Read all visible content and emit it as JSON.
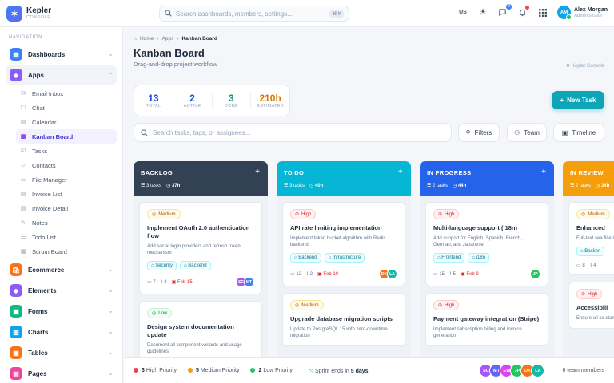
{
  "app": {
    "name": "Kepler",
    "sub": "CONSOLE"
  },
  "search": {
    "placeholder": "Search dashboards, members, settings...",
    "shortcut": "⌘ K"
  },
  "topbar": {
    "lang": "US",
    "chat_badge": "3",
    "user_initials": "AM",
    "user_name": "Alex Morgan",
    "user_role": "Administrator"
  },
  "sidebar": {
    "caption": "NAVIGATION",
    "dashboards": "Dashboards",
    "apps": "Apps",
    "sub": [
      "Email Inbox",
      "Chat",
      "Calendar",
      "Kanban Board",
      "Tasks",
      "Contacts",
      "File Manager",
      "Invoice List",
      "Invoice Detail",
      "Notes",
      "Todo List",
      "Scrum Board"
    ],
    "bottom": [
      "Ecommerce",
      "Elements",
      "Forms",
      "Charts",
      "Tables",
      "Pages"
    ]
  },
  "page": {
    "crumbs": [
      "Home",
      "Apps",
      "Kanban Board"
    ],
    "title": "Kanban Board",
    "subtitle": "Drag-and-drop project workflow",
    "brand": "Kepler Console"
  },
  "stats": [
    {
      "value": "13",
      "label": "TOTAL",
      "color": "#1d4ed8"
    },
    {
      "value": "2",
      "label": "ACTIVE",
      "color": "#1d4ed8"
    },
    {
      "value": "3",
      "label": "DONE",
      "color": "#059669"
    },
    {
      "value": "210h",
      "label": "ESTIMATED",
      "color": "#d97706"
    }
  ],
  "new_task": "New Task",
  "task_search": "Search tasks, tags, or assignees...",
  "buttons": {
    "filters": "Filters",
    "team": "Team",
    "timeline": "Timeline"
  },
  "columns": [
    {
      "title": "BACKLOG",
      "tasks": "3 tasks",
      "hours": "37h",
      "color": "#334155",
      "cards": [
        {
          "priority": "Medium",
          "level": "medium",
          "title": "Implement OAuth 2.0 authentication flow",
          "desc": "Add social login providers and refresh token mechanism",
          "tags": [
            "Security",
            "Backend"
          ],
          "comments": "7",
          "files": "3",
          "due": "Feb 15",
          "avatars": [
            {
              "i": "SC",
              "c": "#a855f7"
            },
            {
              "i": "MT",
              "c": "#3b82f6"
            }
          ]
        },
        {
          "priority": "Low",
          "level": "low",
          "title": "Design system documentation update",
          "desc": "Document all component variants and usage guidelines",
          "tags": [],
          "comments": "",
          "files": "",
          "due": "",
          "avatars": []
        }
      ]
    },
    {
      "title": "TO DO",
      "tasks": "3 tasks",
      "hours": "40h",
      "color": "#06b6d4",
      "cards": [
        {
          "priority": "High",
          "level": "high",
          "title": "API rate limiting implementation",
          "desc": "Implement token bucket algorithm with Redis backend",
          "tags": [
            "Backend",
            "Infrastructure"
          ],
          "comments": "12",
          "files": "2",
          "due": "Feb 10",
          "avatars": [
            {
              "i": "DK",
              "c": "#f97316"
            },
            {
              "i": "LA",
              "c": "#14b8a6"
            }
          ]
        },
        {
          "priority": "Medium",
          "level": "medium",
          "title": "Upgrade database migration scripts",
          "desc": "Update to PostgreSQL 15 with zero-downtime migration",
          "tags": [],
          "comments": "",
          "files": "",
          "due": "",
          "avatars": []
        }
      ]
    },
    {
      "title": "IN PROGRESS",
      "tasks": "2 tasks",
      "hours": "44h",
      "color": "#2563eb",
      "cards": [
        {
          "priority": "High",
          "level": "high",
          "title": "Multi-language support (i18n)",
          "desc": "Add support for English, Spanish, French, German, and Japanese",
          "tags": [
            "Frontend",
            "i18n"
          ],
          "comments": "15",
          "files": "5",
          "due": "Feb 9",
          "avatars": [
            {
              "i": "JP",
              "c": "#22c55e"
            }
          ]
        },
        {
          "priority": "High",
          "level": "high",
          "title": "Payment gateway integration (Stripe)",
          "desc": "Implement subscription billing and invoice generation",
          "tags": [],
          "comments": "",
          "files": "",
          "due": "",
          "avatars": []
        }
      ]
    },
    {
      "title": "IN REVIEW",
      "tasks": "2 tasks",
      "hours": "34h",
      "color": "#f59e0b",
      "cards": [
        {
          "priority": "Medium",
          "level": "medium",
          "title": "Enhanced",
          "desc": "Full-text sea filtering",
          "tags": [
            "Backen"
          ],
          "comments": "8",
          "files": "4",
          "due": "",
          "avatars": []
        },
        {
          "priority": "High",
          "level": "high",
          "title": "Accessibili",
          "desc": "Ensure all co standards",
          "tags": [],
          "comments": "",
          "files": "",
          "due": "",
          "avatars": []
        }
      ]
    }
  ],
  "footer": {
    "high": "3",
    "high_label": "High Priority",
    "medium": "5",
    "medium_label": "Medium Priority",
    "low": "2",
    "low_label": "Low Priority",
    "sprint_label": "Sprint ends in",
    "sprint_value": "5 days",
    "team_count": "6 team members",
    "team": [
      {
        "i": "SC",
        "c": "#a855f7"
      },
      {
        "i": "MT",
        "c": "#6366f1"
      },
      {
        "i": "EW",
        "c": "#d946ef"
      },
      {
        "i": "JP",
        "c": "#22c55e"
      },
      {
        "i": "DK",
        "c": "#f97316"
      },
      {
        "i": "LA",
        "c": "#14b8a6"
      }
    ]
  }
}
